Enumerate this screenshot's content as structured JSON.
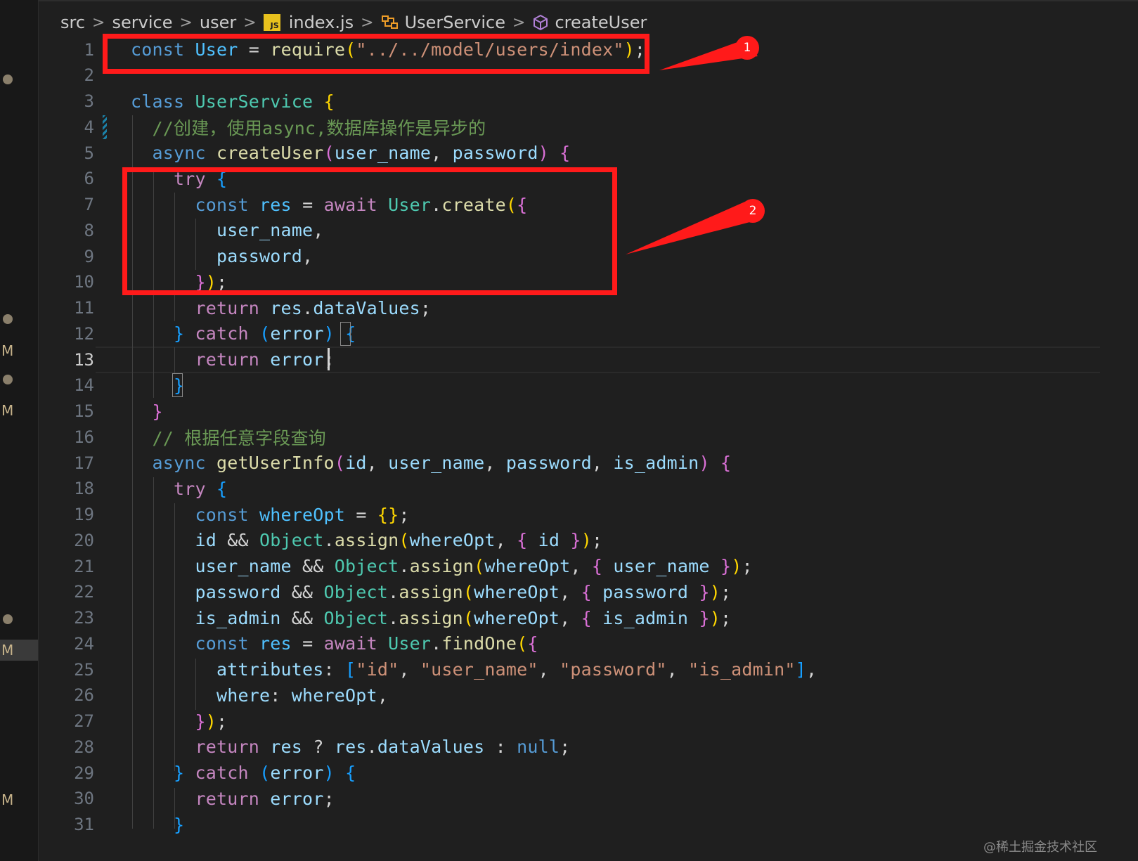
{
  "breadcrumb": {
    "items": [
      "src",
      "service",
      "user",
      "index.js",
      "UserService",
      "createUser"
    ],
    "separator": ">"
  },
  "colors": {
    "annotation": "#ff1a1a",
    "keyword": "#569cd6",
    "control": "#c586c0",
    "class": "#4ec9b0",
    "function": "#dcdcaa",
    "variable": "#9cdcfe",
    "string": "#ce9178",
    "comment": "#6a9955"
  },
  "side_markers": [
    "M",
    "M",
    "M",
    "M"
  ],
  "editor": {
    "current_line": 13,
    "lines": [
      {
        "n": "1",
        "tokens": [
          [
            "kw",
            "const"
          ],
          [
            "op",
            " "
          ],
          [
            "cst",
            "User"
          ],
          [
            "op",
            " = "
          ],
          [
            "fn",
            "require"
          ],
          [
            "br1",
            "("
          ],
          [
            "str",
            "\"../../model/users/index\""
          ],
          [
            "br1",
            ")"
          ],
          [
            "op",
            ";"
          ]
        ]
      },
      {
        "n": "2",
        "tokens": []
      },
      {
        "n": "3",
        "tokens": [
          [
            "kw",
            "class"
          ],
          [
            "op",
            " "
          ],
          [
            "cls",
            "UserService"
          ],
          [
            "op",
            " "
          ],
          [
            "br1",
            "{"
          ]
        ]
      },
      {
        "n": "4",
        "tokens": [
          [
            "op",
            "  "
          ],
          [
            "cmt",
            "//创建，使用async,数据库操作是异步的"
          ]
        ]
      },
      {
        "n": "5",
        "tokens": [
          [
            "op",
            "  "
          ],
          [
            "kw",
            "async"
          ],
          [
            "op",
            " "
          ],
          [
            "fn",
            "createUser"
          ],
          [
            "br2",
            "("
          ],
          [
            "var",
            "user_name"
          ],
          [
            "op",
            ", "
          ],
          [
            "var",
            "password"
          ],
          [
            "br2",
            ")"
          ],
          [
            "op",
            " "
          ],
          [
            "br2",
            "{"
          ]
        ]
      },
      {
        "n": "6",
        "tokens": [
          [
            "op",
            "    "
          ],
          [
            "ctl",
            "try"
          ],
          [
            "op",
            " "
          ],
          [
            "br3",
            "{"
          ]
        ]
      },
      {
        "n": "7",
        "tokens": [
          [
            "op",
            "      "
          ],
          [
            "kw",
            "const"
          ],
          [
            "op",
            " "
          ],
          [
            "cst",
            "res"
          ],
          [
            "op",
            " = "
          ],
          [
            "ctl",
            "await"
          ],
          [
            "op",
            " "
          ],
          [
            "cls",
            "User"
          ],
          [
            "op",
            "."
          ],
          [
            "fn",
            "create"
          ],
          [
            "br1",
            "("
          ],
          [
            "br2",
            "{"
          ]
        ]
      },
      {
        "n": "8",
        "tokens": [
          [
            "op",
            "        "
          ],
          [
            "var",
            "user_name"
          ],
          [
            "op",
            ","
          ]
        ]
      },
      {
        "n": "9",
        "tokens": [
          [
            "op",
            "        "
          ],
          [
            "var",
            "password"
          ],
          [
            "op",
            ","
          ]
        ]
      },
      {
        "n": "10",
        "tokens": [
          [
            "op",
            "      "
          ],
          [
            "br2",
            "}"
          ],
          [
            "br1",
            ")"
          ],
          [
            "op",
            ";"
          ]
        ]
      },
      {
        "n": "11",
        "tokens": [
          [
            "op",
            "      "
          ],
          [
            "ctl",
            "return"
          ],
          [
            "op",
            " "
          ],
          [
            "var",
            "res"
          ],
          [
            "op",
            "."
          ],
          [
            "var",
            "dataValues"
          ],
          [
            "op",
            ";"
          ]
        ]
      },
      {
        "n": "12",
        "tokens": [
          [
            "op",
            "    "
          ],
          [
            "br3",
            "}"
          ],
          [
            "op",
            " "
          ],
          [
            "ctl",
            "catch"
          ],
          [
            "op",
            " "
          ],
          [
            "br3",
            "("
          ],
          [
            "var",
            "error"
          ],
          [
            "br3",
            ")"
          ],
          [
            "op",
            " "
          ],
          [
            "br3",
            "{"
          ]
        ]
      },
      {
        "n": "13",
        "tokens": [
          [
            "op",
            "      "
          ],
          [
            "ctl",
            "return"
          ],
          [
            "op",
            " "
          ],
          [
            "var",
            "error"
          ],
          [
            "op",
            ";"
          ]
        ]
      },
      {
        "n": "14",
        "tokens": [
          [
            "op",
            "    "
          ],
          [
            "br3",
            "}"
          ]
        ]
      },
      {
        "n": "15",
        "tokens": [
          [
            "op",
            "  "
          ],
          [
            "br2",
            "}"
          ]
        ]
      },
      {
        "n": "16",
        "tokens": [
          [
            "op",
            "  "
          ],
          [
            "cmt",
            "// 根据任意字段查询"
          ]
        ]
      },
      {
        "n": "17",
        "tokens": [
          [
            "op",
            "  "
          ],
          [
            "kw",
            "async"
          ],
          [
            "op",
            " "
          ],
          [
            "fn",
            "getUserInfo"
          ],
          [
            "br2",
            "("
          ],
          [
            "var",
            "id"
          ],
          [
            "op",
            ", "
          ],
          [
            "var",
            "user_name"
          ],
          [
            "op",
            ", "
          ],
          [
            "var",
            "password"
          ],
          [
            "op",
            ", "
          ],
          [
            "var",
            "is_admin"
          ],
          [
            "br2",
            ")"
          ],
          [
            "op",
            " "
          ],
          [
            "br2",
            "{"
          ]
        ]
      },
      {
        "n": "18",
        "tokens": [
          [
            "op",
            "    "
          ],
          [
            "ctl",
            "try"
          ],
          [
            "op",
            " "
          ],
          [
            "br3",
            "{"
          ]
        ]
      },
      {
        "n": "19",
        "tokens": [
          [
            "op",
            "      "
          ],
          [
            "kw",
            "const"
          ],
          [
            "op",
            " "
          ],
          [
            "cst",
            "whereOpt"
          ],
          [
            "op",
            " = "
          ],
          [
            "br1",
            "{}"
          ],
          [
            "op",
            ";"
          ]
        ]
      },
      {
        "n": "20",
        "tokens": [
          [
            "op",
            "      "
          ],
          [
            "var",
            "id"
          ],
          [
            "op",
            " && "
          ],
          [
            "cls",
            "Object"
          ],
          [
            "op",
            "."
          ],
          [
            "fn",
            "assign"
          ],
          [
            "br1",
            "("
          ],
          [
            "var",
            "whereOpt"
          ],
          [
            "op",
            ", "
          ],
          [
            "br2",
            "{"
          ],
          [
            "op",
            " "
          ],
          [
            "var",
            "id"
          ],
          [
            "op",
            " "
          ],
          [
            "br2",
            "}"
          ],
          [
            "br1",
            ")"
          ],
          [
            "op",
            ";"
          ]
        ]
      },
      {
        "n": "21",
        "tokens": [
          [
            "op",
            "      "
          ],
          [
            "var",
            "user_name"
          ],
          [
            "op",
            " && "
          ],
          [
            "cls",
            "Object"
          ],
          [
            "op",
            "."
          ],
          [
            "fn",
            "assign"
          ],
          [
            "br1",
            "("
          ],
          [
            "var",
            "whereOpt"
          ],
          [
            "op",
            ", "
          ],
          [
            "br2",
            "{"
          ],
          [
            "op",
            " "
          ],
          [
            "var",
            "user_name"
          ],
          [
            "op",
            " "
          ],
          [
            "br2",
            "}"
          ],
          [
            "br1",
            ")"
          ],
          [
            "op",
            ";"
          ]
        ]
      },
      {
        "n": "22",
        "tokens": [
          [
            "op",
            "      "
          ],
          [
            "var",
            "password"
          ],
          [
            "op",
            " && "
          ],
          [
            "cls",
            "Object"
          ],
          [
            "op",
            "."
          ],
          [
            "fn",
            "assign"
          ],
          [
            "br1",
            "("
          ],
          [
            "var",
            "whereOpt"
          ],
          [
            "op",
            ", "
          ],
          [
            "br2",
            "{"
          ],
          [
            "op",
            " "
          ],
          [
            "var",
            "password"
          ],
          [
            "op",
            " "
          ],
          [
            "br2",
            "}"
          ],
          [
            "br1",
            ")"
          ],
          [
            "op",
            ";"
          ]
        ]
      },
      {
        "n": "23",
        "tokens": [
          [
            "op",
            "      "
          ],
          [
            "var",
            "is_admin"
          ],
          [
            "op",
            " && "
          ],
          [
            "cls",
            "Object"
          ],
          [
            "op",
            "."
          ],
          [
            "fn",
            "assign"
          ],
          [
            "br1",
            "("
          ],
          [
            "var",
            "whereOpt"
          ],
          [
            "op",
            ", "
          ],
          [
            "br2",
            "{"
          ],
          [
            "op",
            " "
          ],
          [
            "var",
            "is_admin"
          ],
          [
            "op",
            " "
          ],
          [
            "br2",
            "}"
          ],
          [
            "br1",
            ")"
          ],
          [
            "op",
            ";"
          ]
        ]
      },
      {
        "n": "24",
        "tokens": [
          [
            "op",
            "      "
          ],
          [
            "kw",
            "const"
          ],
          [
            "op",
            " "
          ],
          [
            "cst",
            "res"
          ],
          [
            "op",
            " = "
          ],
          [
            "ctl",
            "await"
          ],
          [
            "op",
            " "
          ],
          [
            "cls",
            "User"
          ],
          [
            "op",
            "."
          ],
          [
            "fn",
            "findOne"
          ],
          [
            "br1",
            "("
          ],
          [
            "br2",
            "{"
          ]
        ]
      },
      {
        "n": "25",
        "tokens": [
          [
            "op",
            "        "
          ],
          [
            "var",
            "attributes"
          ],
          [
            "op",
            ": "
          ],
          [
            "br3",
            "["
          ],
          [
            "str",
            "\"id\""
          ],
          [
            "op",
            ", "
          ],
          [
            "str",
            "\"user_name\""
          ],
          [
            "op",
            ", "
          ],
          [
            "str",
            "\"password\""
          ],
          [
            "op",
            ", "
          ],
          [
            "str",
            "\"is_admin\""
          ],
          [
            "br3",
            "]"
          ],
          [
            "op",
            ","
          ]
        ]
      },
      {
        "n": "26",
        "tokens": [
          [
            "op",
            "        "
          ],
          [
            "var",
            "where"
          ],
          [
            "op",
            ": "
          ],
          [
            "var",
            "whereOpt"
          ],
          [
            "op",
            ","
          ]
        ]
      },
      {
        "n": "27",
        "tokens": [
          [
            "op",
            "      "
          ],
          [
            "br2",
            "}"
          ],
          [
            "br1",
            ")"
          ],
          [
            "op",
            ";"
          ]
        ]
      },
      {
        "n": "28",
        "tokens": [
          [
            "op",
            "      "
          ],
          [
            "ctl",
            "return"
          ],
          [
            "op",
            " "
          ],
          [
            "var",
            "res"
          ],
          [
            "op",
            " ? "
          ],
          [
            "var",
            "res"
          ],
          [
            "op",
            "."
          ],
          [
            "var",
            "dataValues"
          ],
          [
            "op",
            " : "
          ],
          [
            "kw",
            "null"
          ],
          [
            "op",
            ";"
          ]
        ]
      },
      {
        "n": "29",
        "tokens": [
          [
            "op",
            "    "
          ],
          [
            "br3",
            "}"
          ],
          [
            "op",
            " "
          ],
          [
            "ctl",
            "catch"
          ],
          [
            "op",
            " "
          ],
          [
            "br3",
            "("
          ],
          [
            "var",
            "error"
          ],
          [
            "br3",
            ")"
          ],
          [
            "op",
            " "
          ],
          [
            "br3",
            "{"
          ]
        ]
      },
      {
        "n": "30",
        "tokens": [
          [
            "op",
            "      "
          ],
          [
            "ctl",
            "return"
          ],
          [
            "op",
            " "
          ],
          [
            "var",
            "error"
          ],
          [
            "op",
            ";"
          ]
        ]
      },
      {
        "n": "31",
        "tokens": [
          [
            "op",
            "    "
          ],
          [
            "br3",
            "}"
          ]
        ]
      }
    ]
  },
  "annotations": [
    "1",
    "2"
  ],
  "watermark": "@稀土掘金技术社区"
}
